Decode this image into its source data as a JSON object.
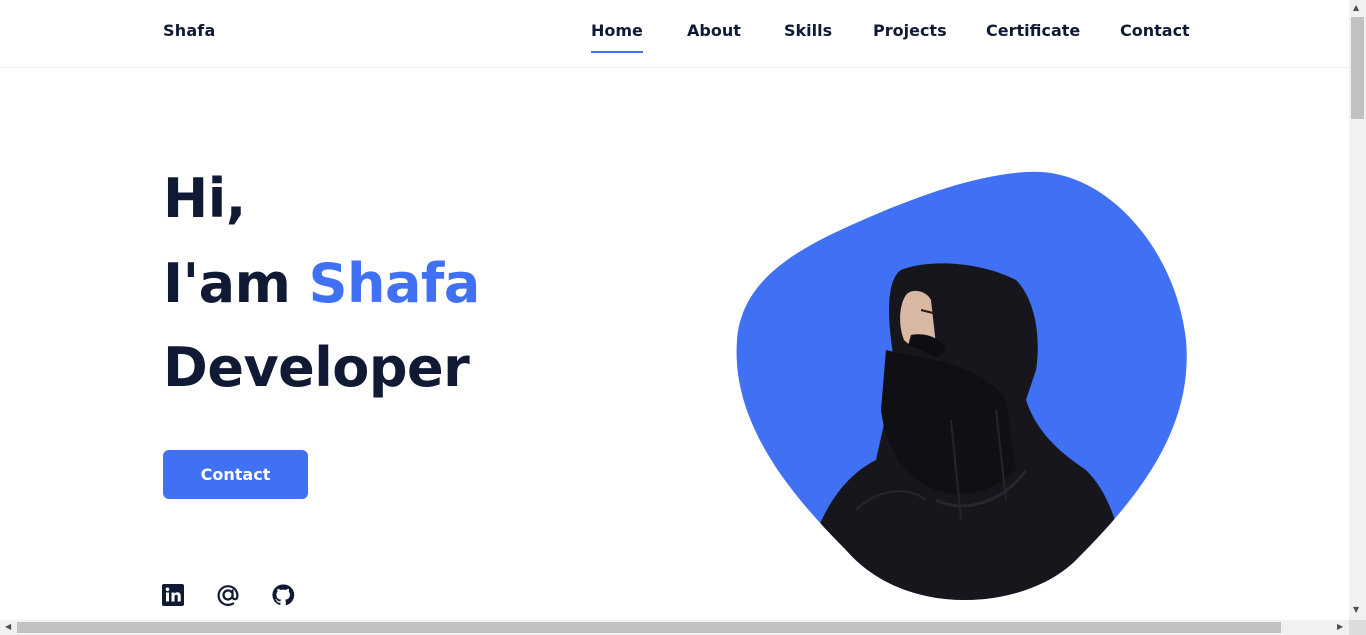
{
  "header": {
    "logo": "Shafa",
    "nav": [
      {
        "label": "Home",
        "active": true
      },
      {
        "label": "About",
        "active": false
      },
      {
        "label": "Skills",
        "active": false
      },
      {
        "label": "Projects",
        "active": false
      },
      {
        "label": "Certificate",
        "active": false
      },
      {
        "label": "Contact",
        "active": false
      }
    ]
  },
  "hero": {
    "line1": "Hi,",
    "line2_prefix": "I'am ",
    "line2_name": "Shafa",
    "line3": "Developer",
    "button_label": "Contact"
  },
  "social": [
    {
      "icon": "linkedin-icon"
    },
    {
      "icon": "at-sign-icon"
    },
    {
      "icon": "github-icon"
    }
  ],
  "colors": {
    "accent": "#4070f4",
    "text": "#111a35",
    "background": "#ffffff"
  }
}
